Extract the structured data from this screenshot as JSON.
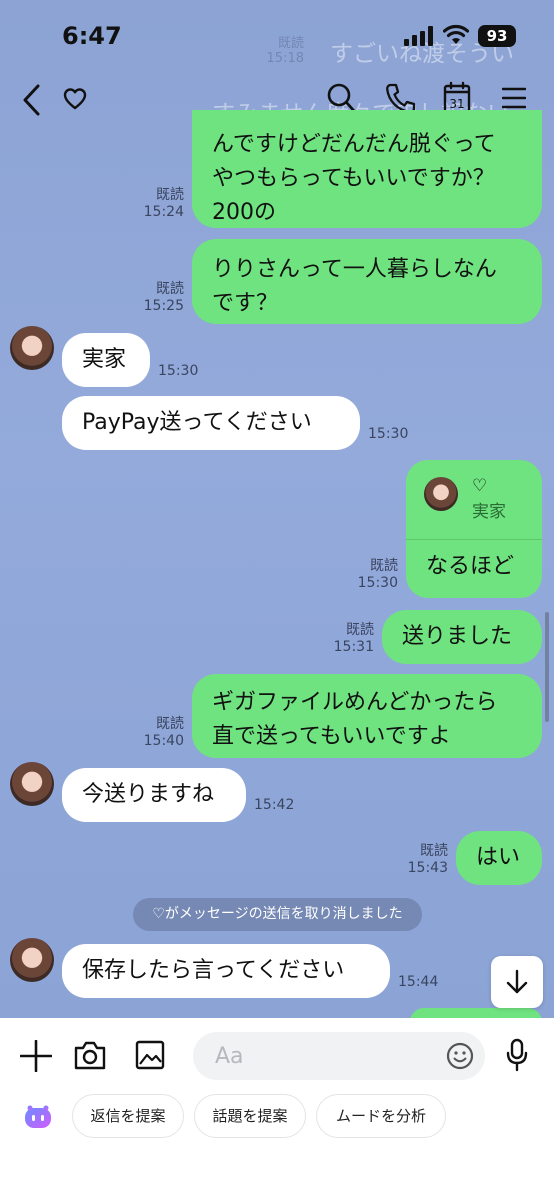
{
  "status_bar": {
    "time": "6:47",
    "battery": "93"
  },
  "header": {
    "chat_name_icon": "heart-icon"
  },
  "ghost_messages": [
    {
      "text": "すごいね渡そうい",
      "time": "15:18"
    },
    {
      "text": "すみません度々で申し訳ない",
      "time": ""
    }
  ],
  "messages": [
    {
      "side": "out",
      "text": "んですけどだんだん脱ぐって\nやつもらってもいいですか？\n200の",
      "read": "既読",
      "time": "15:24"
    },
    {
      "side": "out",
      "text": "りりさんって一人暮らしなん\nです？",
      "read": "既読",
      "time": "15:25"
    },
    {
      "side": "in",
      "text": "実家",
      "time": "15:30"
    },
    {
      "side": "in",
      "text": "PayPay送ってください",
      "time": "15:30"
    },
    {
      "side": "out",
      "reply_name": "♡",
      "reply_text": "実家",
      "text": "なるほど",
      "read": "既読",
      "time": "15:30"
    },
    {
      "side": "out",
      "text": "送りました",
      "read": "既読",
      "time": "15:31"
    },
    {
      "side": "out",
      "text": "ギガファイルめんどかったら\n直で送ってもいいですよ",
      "read": "既読",
      "time": "15:40"
    },
    {
      "side": "in",
      "text": "今送りますね",
      "time": "15:42"
    },
    {
      "side": "out",
      "text": "はい",
      "read": "既読",
      "time": "15:43"
    },
    {
      "side": "in",
      "text": "保存したら言ってください",
      "time": "15:44"
    }
  ],
  "system_notice": "♡がメッセージの送信を取り消しました",
  "composer": {
    "placeholder": "Aa",
    "suggestions": [
      "返信を提案",
      "話題を提案",
      "ムードを分析"
    ]
  },
  "colors": {
    "outgoing_bubble": "#6fe37f",
    "incoming_bubble": "#ffffff",
    "background": "#8ea5d6"
  }
}
